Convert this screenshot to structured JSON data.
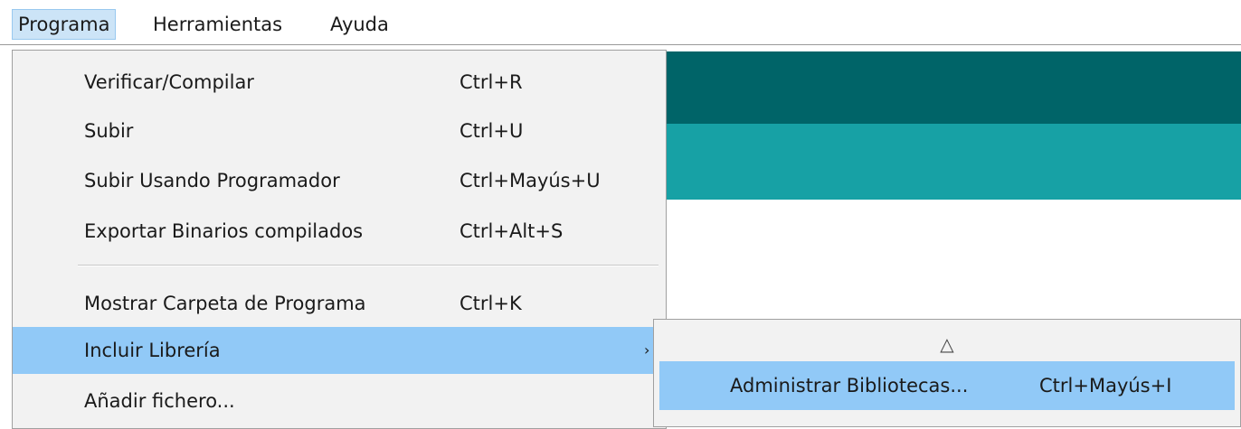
{
  "menubar": {
    "items": [
      {
        "label": "Programa"
      },
      {
        "label": "Herramientas"
      },
      {
        "label": "Ayuda"
      }
    ]
  },
  "programa_menu": {
    "items": [
      {
        "label": "Verificar/Compilar",
        "shortcut": "Ctrl+R"
      },
      {
        "label": "Subir",
        "shortcut": "Ctrl+U"
      },
      {
        "label": "Subir Usando Programador",
        "shortcut": "Ctrl+Mayús+U"
      },
      {
        "label": "Exportar Binarios compilados",
        "shortcut": "Ctrl+Alt+S"
      },
      {
        "label": "Mostrar Carpeta de Programa",
        "shortcut": "Ctrl+K"
      },
      {
        "label": "Incluir Librería",
        "shortcut": "",
        "arrow": "›"
      },
      {
        "label": "Añadir fichero...",
        "shortcut": ""
      }
    ]
  },
  "incluir_libreria_submenu": {
    "scroll_indicator": "△",
    "items": [
      {
        "label": "Administrar Bibliotecas...",
        "shortcut": "Ctrl+Mayús+I"
      }
    ]
  },
  "colors": {
    "editor_header_dark": "#006468",
    "editor_header_teal": "#17a1a5",
    "highlight": "#91c9f7"
  }
}
